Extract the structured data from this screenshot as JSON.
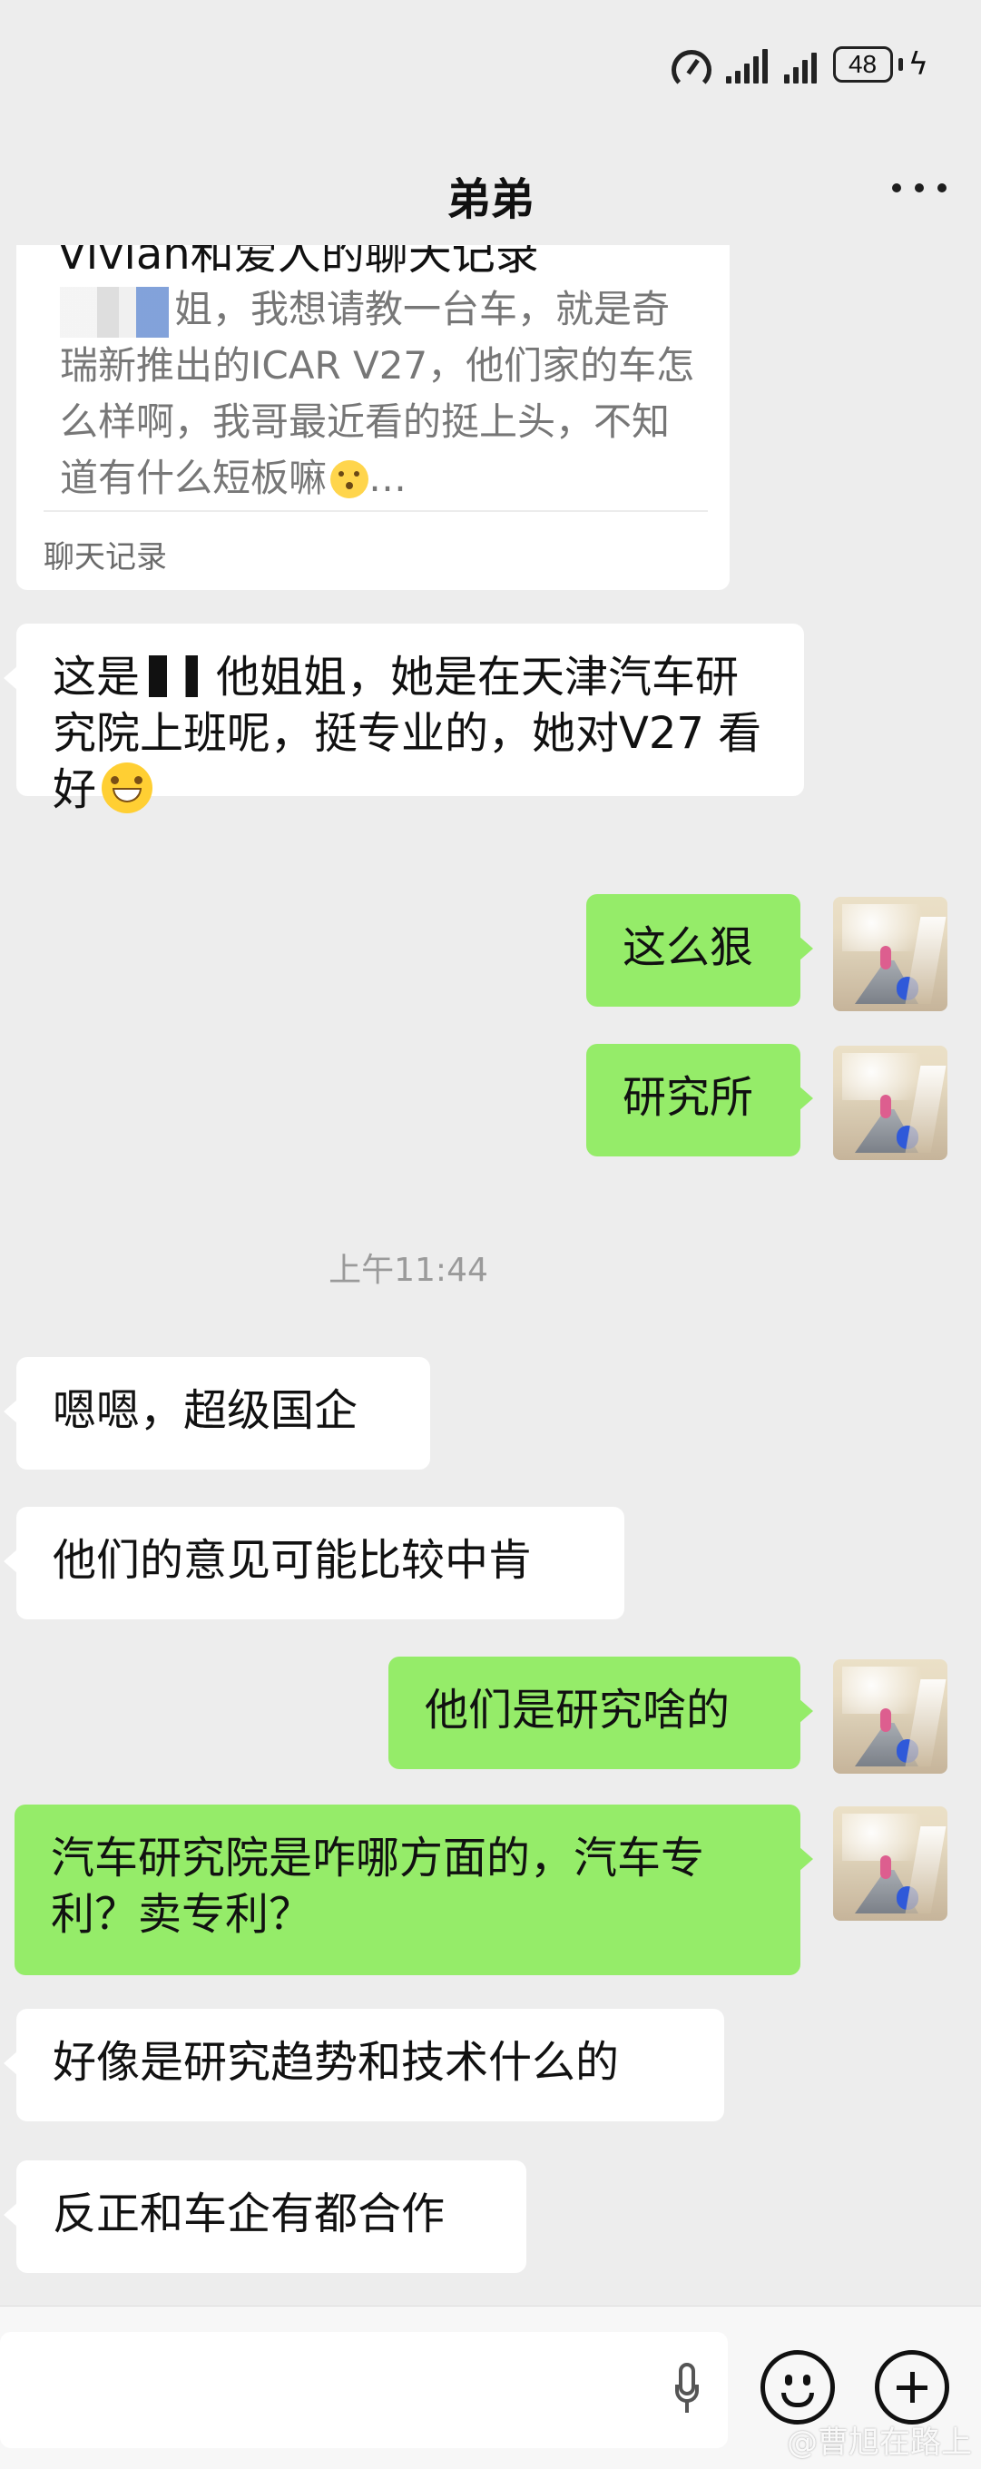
{
  "status_bar": {
    "battery": "48"
  },
  "header": {
    "title": "弟弟"
  },
  "forward_card": {
    "title": "Vivian和爱人的聊天记录",
    "text_1": "姐，我想请教一台车，就是奇瑞新推出的ICAR V27，他们家的车怎么样啊，我哥最近看的挺上头，不知道有什么短板嘛",
    "text_2": "…",
    "label": "聊天记录"
  },
  "messages": {
    "m1_a": "这是",
    "m1_b": "他姐姐，她是在天津汽车研究院上班呢，挺专业的，她对V27 看好",
    "m2": "这么狠",
    "m3": "研究所",
    "time": "上午11:44",
    "m4": "嗯嗯，超级国企",
    "m5": "他们的意见可能比较中肯",
    "m6": "他们是研究啥的",
    "m7": "汽车研究院是咋哪方面的，汽车专利？卖专利？",
    "m8": "好像是研究趋势和技术什么的",
    "m9": "反正和车企有都合作"
  },
  "watermark": "@曹旭在路上"
}
